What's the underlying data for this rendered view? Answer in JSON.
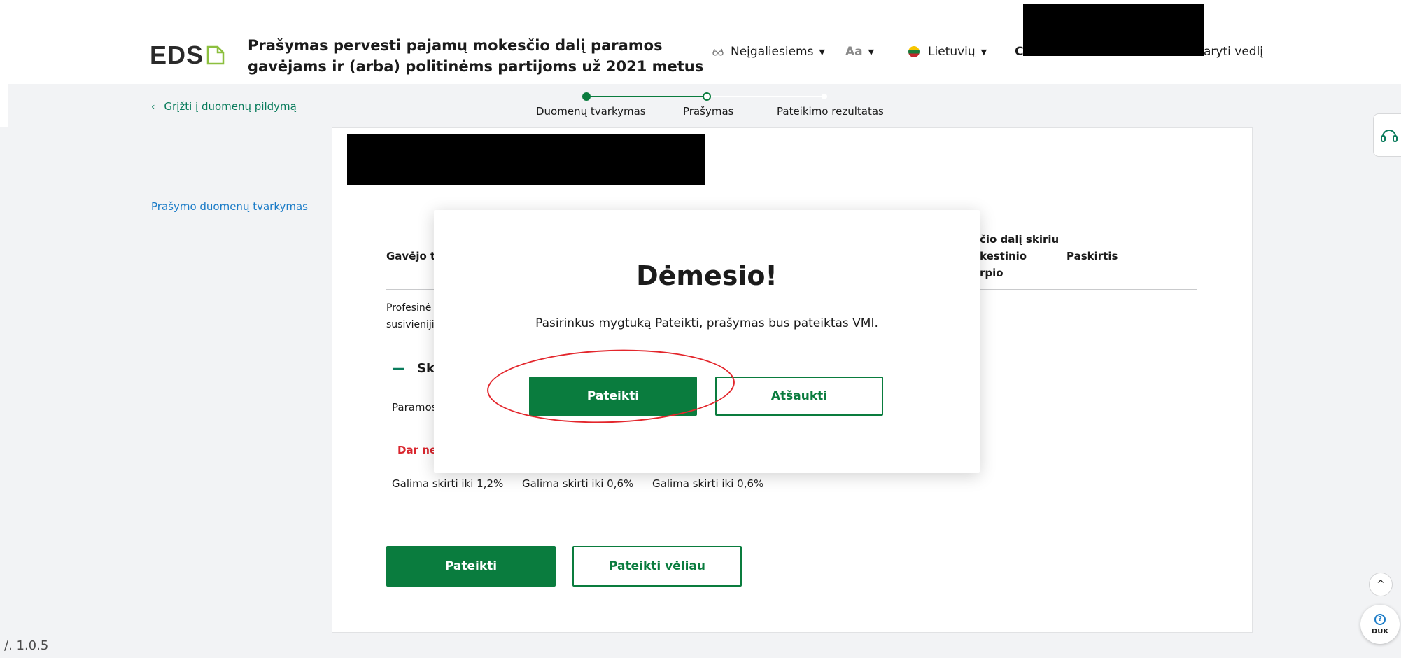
{
  "header": {
    "logo_text": "EDS",
    "title": "Prašymas pervesti pajamų mokesčio dalį paramos gavėjams ir (arba) politinėms partijoms už 2021 metus",
    "a11y_label": "Neįgaliesiems",
    "font_label": "Aa",
    "lang_label": "Lietuvių",
    "user_initial": "C",
    "guide_label": "aryti vedlį"
  },
  "stepbar": {
    "back_label": "Grįžti į duomenų pildymą",
    "steps": [
      {
        "label": "Duomenų tvarkymas",
        "state": "done"
      },
      {
        "label": "Prašymas",
        "state": "current"
      },
      {
        "label": "Pateikimo rezultatas",
        "state": "todo"
      }
    ]
  },
  "sidebar": {
    "link_label": "Prašymo duomenų tvarkymas"
  },
  "table": {
    "col_type": "Gavėjo ti",
    "col_share_line1": "čio dalį skiriu",
    "col_share_line2": "kestinio",
    "col_share_line3": "rpio",
    "col_purpose": "Paskirtis",
    "row1_line1": "Profesinė",
    "row1_line2": "susivieniji"
  },
  "section": {
    "collapse_symbol": "—",
    "title": "Ski",
    "paramos_label": "Paramos",
    "warning": "Dar ne",
    "limits": [
      "Galima skirti iki 1,2%",
      "Galima skirti iki 0,6%",
      "Galima skirti iki 0,6%"
    ]
  },
  "actions": {
    "submit_label": "Pateikti",
    "later_label": "Pateikti vėliau"
  },
  "modal": {
    "title": "Dėmesio!",
    "message": "Pasirinkus mygtuką Pateikti, prašymas bus pateiktas VMI.",
    "confirm_label": "Pateikti",
    "cancel_label": "Atšaukti"
  },
  "footer": {
    "version": "/. 1.0.5"
  },
  "widgets": {
    "scroll_up_symbol": "^",
    "duk_symbol": "?",
    "duk_label": "DUK"
  },
  "colors": {
    "primary_green": "#0a7c3e",
    "link_blue": "#1a7bc7",
    "warning_red": "#d9262e",
    "annotation_red": "#e3262c"
  }
}
